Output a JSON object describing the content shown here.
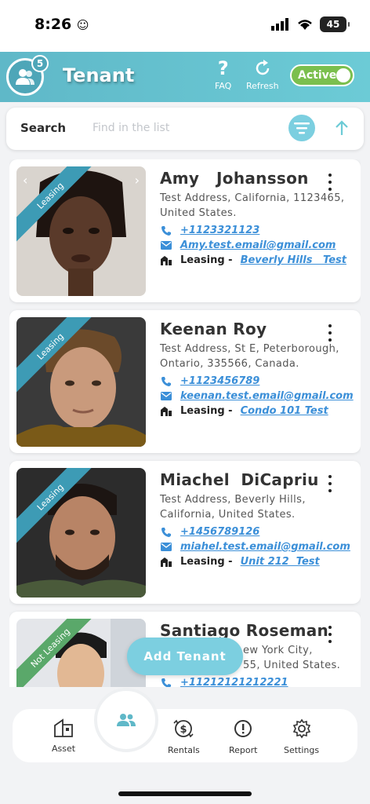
{
  "status_bar": {
    "time": "8:26",
    "battery": "45"
  },
  "header": {
    "title": "Tenant",
    "badge_count": "5",
    "faq_label": "FAQ",
    "refresh_label": "Refresh",
    "toggle_label": "Active",
    "toggle_on": true,
    "colors": {
      "accent": "#6ccbd6",
      "toggle": "#7bbf4e"
    }
  },
  "search": {
    "label": "Search",
    "placeholder": "Find in the list"
  },
  "tenants": [
    {
      "name": "Amy   Johansson",
      "address": "Test Address, California, 1123465, United States.",
      "phone": "+1123321123",
      "email": "Amy.test.email@gmail.com",
      "leasing_label": "Leasing -",
      "property": "Beverly Hills   Test",
      "ribbon": "Leasing",
      "ribbon_color": "#3d9bb5"
    },
    {
      "name": "Keenan Roy",
      "address": "Test Address, St E, Peterborough, Ontario, 335566, Canada.",
      "phone": "+1123456789",
      "email": "keenan.test.email@gmail.com",
      "leasing_label": "Leasing -",
      "property": "Condo 101 Test",
      "ribbon": "Leasing",
      "ribbon_color": "#3d9bb5"
    },
    {
      "name": "Miachel  DiCapriu",
      "address": "Test Address, Beverly Hills, California, United States.",
      "phone": "+1456789126",
      "email": "miahel.test.email@gmail.com",
      "leasing_label": "Leasing -",
      "property": "Unit 212  Test",
      "ribbon": "Leasing",
      "ribbon_color": "#3d9bb5"
    },
    {
      "name": "Santiago Roseman",
      "address_line1": "ew York City,",
      "address_line2": "55, United States.",
      "phone": "+11212121212221",
      "ribbon": "Not Leasing",
      "ribbon_color": "#5aa86a"
    }
  ],
  "add_button": "Add Tenant",
  "nav": {
    "asset": "Asset",
    "rentals": "Rentals",
    "report": "Report",
    "settings": "Settings"
  }
}
